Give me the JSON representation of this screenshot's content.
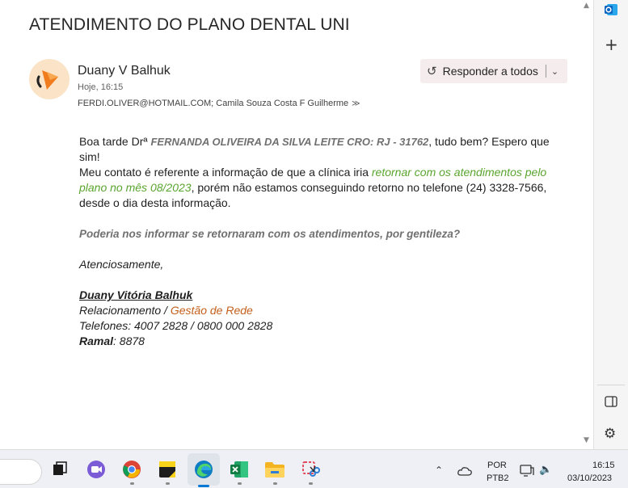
{
  "email": {
    "subject": "ATENDIMENTO DO PLANO DENTAL UNI",
    "sender": "Duany V Balhuk",
    "sent_time": "Hoje, 16:15",
    "recipients": "FERDI.OLIVER@HOTMAIL.COM; Camila Souza Costa F Guilherme",
    "reply_all_label": "Responder a todos",
    "body": {
      "p1_start": "Boa tarde Drª ",
      "p1_name": "FERNANDA OLIVEIRA DA SILVA LEITE CRO: RJ - 31762",
      "p1_end": ", tudo bem? Espero que sim!",
      "p2_start": "Meu contato é referente a informação de que a clínica iria ",
      "p2_green": "retornar com os atendimentos pelo plano no mês 08/2023",
      "p2_end": ", porém não estamos conseguindo retorno no telefone (24) 3328-7566, desde o dia desta informação.",
      "p3": "Poderia nos informar se retornaram com os atendimentos, por gentileza?",
      "closing": "Atenciosamente,",
      "sig_name": "Duany Vitória Balhuk ",
      "sig_role_a": "Relacionamento / ",
      "sig_role_b": "Gestão de Rede",
      "sig_phones": "Telefones: 4007 2828 / 0800 000 2828",
      "sig_ramal_label": "Ramal",
      "sig_ramal_value": ": 8878"
    }
  },
  "side_rail": {
    "app_icon": "outlook-icon",
    "add_icon": "plus-icon",
    "panel_icon": "panel-icon",
    "settings_icon": "gear-icon"
  },
  "taskbar": {
    "apps": [
      "task-view-icon",
      "teams-icon",
      "chrome-icon",
      "sticky-notes-icon",
      "edge-icon",
      "excel-icon",
      "file-explorer-icon",
      "snipping-tool-icon"
    ],
    "lang_line1": "POR",
    "lang_line2": "PTB2",
    "time": "16:15",
    "date": "03/10/2023",
    "colors": {
      "accent": "#0078d4",
      "green": "#5aa52f",
      "orange": "#c35f1d"
    }
  }
}
